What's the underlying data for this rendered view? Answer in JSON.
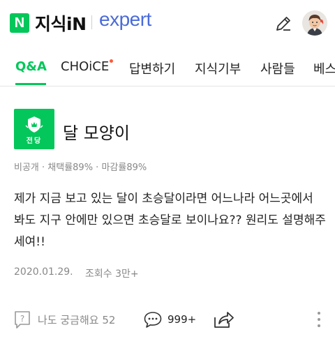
{
  "header": {
    "naver_logo_letter": "N",
    "service_name": "지식iN",
    "expert_label": "expert",
    "write_icon": "pencil-icon",
    "avatar_icon": "profile-avatar"
  },
  "tabs": [
    {
      "label": "Q&A",
      "active": true
    },
    {
      "label": "CHOiCE",
      "active": false,
      "new_dot": true
    },
    {
      "label": "답변하기",
      "active": false
    },
    {
      "label": "지식기부",
      "active": false
    },
    {
      "label": "사람들",
      "active": false
    },
    {
      "label": "베스",
      "active": false
    }
  ],
  "question": {
    "badge_label": "전당",
    "title": "달 모양이",
    "meta": "비공개 · 채택률89% · 마감률89%",
    "body": "제가 지금 보고 있는 달이 초승달이라면 어느나라 어느곳에서 봐도 지구 안에만 있으면 초승달로 보이나요?? 원리도 설명해주세여!!",
    "date": "2020.01.29.",
    "views": "조회수 3만+"
  },
  "actions": {
    "curious_label": "나도 궁금해요 52",
    "answers_count": "999+",
    "share_icon": "share-icon",
    "more_icon": "more-vertical-icon"
  },
  "colors": {
    "brand_green": "#03c75a",
    "expert_blue": "#4a6bd9",
    "new_dot": "#ff5a3c"
  }
}
